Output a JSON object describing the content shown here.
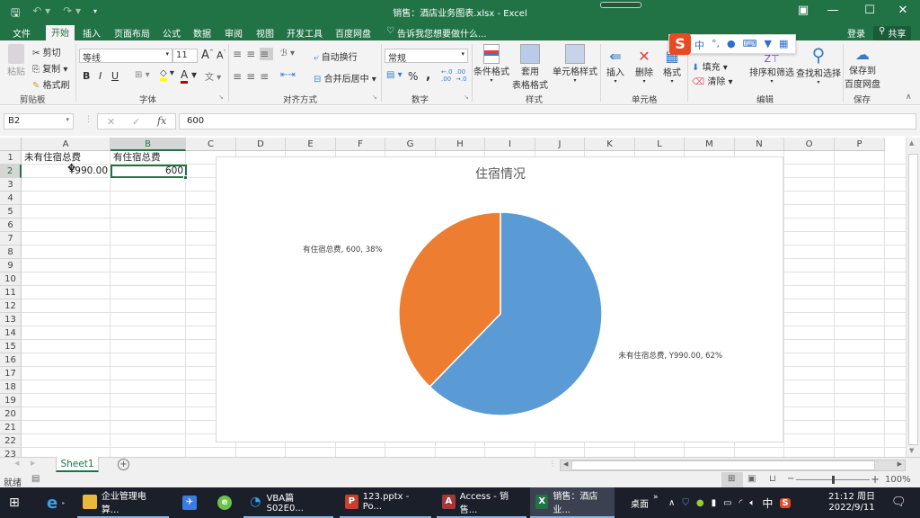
{
  "titlebar": {
    "title": "销售：酒店业务图表.xlsx - Excel",
    "qat": {
      "save_icon": "save-icon",
      "undo_icon": "undo-icon",
      "redo_icon": "redo-icon",
      "customize_icon": "customize-qat-icon"
    },
    "controls": {
      "ribbon_display": "▣",
      "minimize": "—",
      "maximize": "☐",
      "close": "✕"
    }
  },
  "menu": {
    "tabs": [
      "文件",
      "开始",
      "插入",
      "页面布局",
      "公式",
      "数据",
      "审阅",
      "视图",
      "开发工具",
      "百度网盘"
    ],
    "active_tab": "开始",
    "tell_me": "告诉我您想要做什么...",
    "signin": "登录",
    "share": "共享"
  },
  "ribbon": {
    "clipboard": {
      "paste": "粘贴",
      "cut": "剪切",
      "copy": "复制",
      "format_painter": "格式刷",
      "label": "剪贴板"
    },
    "font": {
      "font_name": "等线",
      "font_size": "11",
      "grow": "A",
      "shrink": "A",
      "bold": "B",
      "italic": "I",
      "underline": "U",
      "label": "字体",
      "highlight_color": "#ffff00",
      "font_color": "#c00000"
    },
    "alignment": {
      "wrap": "自动换行",
      "merge": "合并后居中",
      "label": "对齐方式"
    },
    "number": {
      "format": "常规",
      "percent": "%",
      "comma": ",",
      "inc_decimal": "←.0 .00",
      "dec_decimal": ".00 →.0",
      "label": "数字"
    },
    "styles": {
      "conditional": "条件格式",
      "table_line1": "套用",
      "table_line2": "表格格式",
      "cell_styles": "单元格样式",
      "label": "样式"
    },
    "cells": {
      "insert": "插入",
      "delete": "删除",
      "format": "格式",
      "label": "单元格"
    },
    "editing": {
      "fill": "填充",
      "clear": "清除",
      "sort": "排序和筛选",
      "find": "查找和选择",
      "label": "编辑"
    },
    "save": {
      "line1": "保存到",
      "line2": "百度网盘",
      "label": "保存"
    }
  },
  "ime": {
    "logo": "S",
    "items": [
      "中",
      "°,",
      "🎤",
      "⌨",
      "👕",
      "▦"
    ]
  },
  "formula_bar": {
    "name_box": "B2",
    "cancel": "✕",
    "enter": "✓",
    "fx": "fx",
    "value": "600"
  },
  "sheet": {
    "columns": [
      "A",
      "B",
      "C",
      "D",
      "E",
      "F",
      "G",
      "H",
      "I",
      "J",
      "K",
      "L",
      "M",
      "N",
      "O",
      "P"
    ],
    "rows": [
      "1",
      "2",
      "3",
      "4",
      "5",
      "6",
      "7",
      "8",
      "9",
      "10",
      "11",
      "12",
      "13",
      "14",
      "15",
      "16",
      "17",
      "18",
      "19",
      "20",
      "21",
      "22",
      "23"
    ],
    "selected_cell": "B2",
    "cells": {
      "A1": "未有住宿总费",
      "B1": "有住宿总费",
      "A2": "¥990.00",
      "B2": "600"
    }
  },
  "chart_data": {
    "type": "pie",
    "title": "住宿情况",
    "categories": [
      "未有住宿总费",
      "有住宿总费"
    ],
    "values": [
      990,
      600
    ],
    "percentages": [
      62,
      38
    ],
    "colors": [
      "#5b9bd5",
      "#ed7d31"
    ],
    "data_labels": [
      "未有住宿总费, Y990.00, 62%",
      "有住宿总费, 600, 38%"
    ],
    "start_angle_deg": 0,
    "legend": "none"
  },
  "sheet_tabs": {
    "tabs": [
      "Sheet1"
    ],
    "active": "Sheet1",
    "add": "+"
  },
  "statusbar": {
    "status": "就绪",
    "zoom_percent": "100%",
    "zoom_minus": "−",
    "zoom_plus": "+",
    "zoom_level": 100
  },
  "taskbar": {
    "items": [
      {
        "label": "企业管理电算...",
        "icon": "folder-icon"
      },
      {
        "label": "VBA篇 S02E0...",
        "icon": "video-icon"
      },
      {
        "label": "123.pptx - Po...",
        "icon": "powerpoint-icon"
      },
      {
        "label": "Access - 销售...",
        "icon": "access-icon"
      },
      {
        "label": "销售：酒店业...",
        "icon": "excel-icon"
      }
    ],
    "desktop": "桌面",
    "ime_lang": "中",
    "time": "21:12 周日",
    "date": "2022/9/11"
  }
}
